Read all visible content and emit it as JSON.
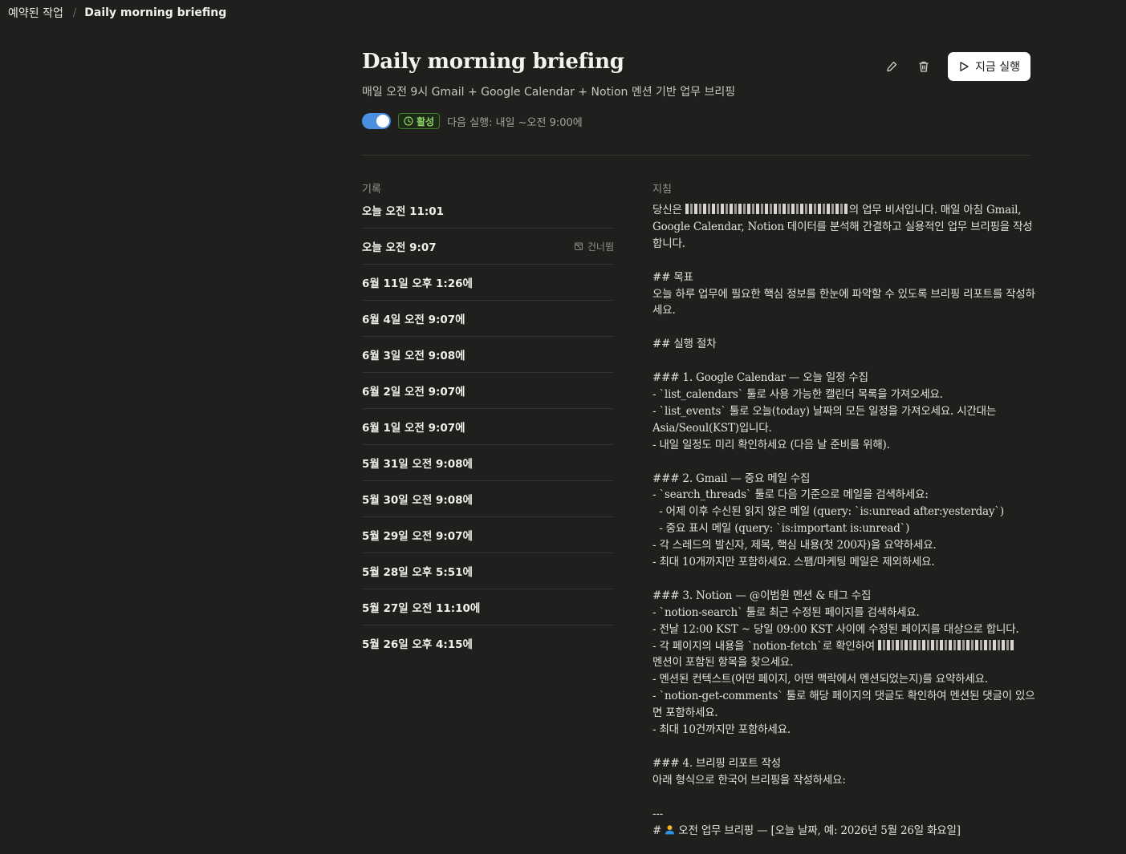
{
  "breadcrumb": {
    "parent": "예약된 작업",
    "separator": "/",
    "current": "Daily morning briefing"
  },
  "header": {
    "title": "Daily morning briefing",
    "subtitle": "매일 오전 9시 Gmail + Google Calendar + Notion 멘션 기반 업무 브리핑",
    "toggle_enabled": true,
    "status_badge": "활성",
    "next_run": "다음 실행: 내일 ~오전 9:00에",
    "run_now_label": "지금 실행"
  },
  "icons": {
    "edit": "pencil-icon",
    "delete": "trash-icon",
    "run": "play-icon",
    "status": "clock-icon",
    "skipped": "skip-icon"
  },
  "colors": {
    "background": "#1f1f1e",
    "toggle": "#4a8fe0",
    "badge_green": "#8ed46a",
    "run_button": "#ffffff"
  },
  "history": {
    "label": "기록",
    "items": [
      {
        "time": "오늘 오전 11:01",
        "status": ""
      },
      {
        "time": "오늘 오전 9:07",
        "status": "건너뜀"
      },
      {
        "time": "6월 11일 오후 1:26에",
        "status": ""
      },
      {
        "time": "6월 4일 오전 9:07에",
        "status": ""
      },
      {
        "time": "6월 3일 오전 9:08에",
        "status": ""
      },
      {
        "time": "6월 2일 오전 9:07에",
        "status": ""
      },
      {
        "time": "6월 1일 오전 9:07에",
        "status": ""
      },
      {
        "time": "5월 31일 오전 9:08에",
        "status": ""
      },
      {
        "time": "5월 30일 오전 9:08에",
        "status": ""
      },
      {
        "time": "5월 29일 오전 9:07에",
        "status": ""
      },
      {
        "time": "5월 28일 오후 5:51에",
        "status": ""
      },
      {
        "time": "5월 27일 오전 11:10에",
        "status": ""
      },
      {
        "time": "5월 26일 오후 4:15에",
        "status": ""
      }
    ]
  },
  "instructions": {
    "label": "지침",
    "intro_before": "당신은 ",
    "intro_after": "의 업무 비서입니다. 매일 아침 Gmail, Google Calendar, Notion 데이터를 분석해 간결하고 실용적인 업무 브리핑을 작성합니다.",
    "block1": "## 목표\n오늘 하루 업무에 필요한 핵심 정보를 한눈에 파악할 수 있도록 브리핑 리포트를 작성하세요.\n\n## 실행 절차\n\n### 1. Google Calendar — 오늘 일정 수집\n- `list_calendars` 툴로 사용 가능한 캘린더 목록을 가져오세요.\n- `list_events` 툴로 오늘(today) 날짜의 모든 일정을 가져오세요. 시간대는 Asia/Seoul(KST)입니다.\n- 내일 일정도 미리 확인하세요 (다음 날 준비를 위해).\n\n### 2. Gmail — 중요 메일 수집\n- `search_threads` 툴로 다음 기준으로 메일을 검색하세요:\n  - 어제 이후 수신된 읽지 않은 메일 (query: `is:unread after:yesterday`)\n  - 중요 표시 메일 (query: `is:important is:unread`)\n- 각 스레드의 발신자, 제목, 핵심 내용(첫 200자)을 요약하세요.\n- 최대 10개까지만 포함하세요. 스팸/마케팅 메일은 제외하세요.\n\n### 3. Notion — @이범원 멘션 & 태그 수집\n- `notion-search` 툴로 최근 수정된 페이지를 검색하세요.\n- 전날 12:00 KST ~ 당일 09:00 KST 사이에 수정된 페이지를 대상으로 합니다.\n- 각 페이지의 내용을 `notion-fetch`로 확인하여 ",
    "block2": "\n멘션이 포함된 항목을 찾으세요.\n- 멘션된 컨텍스트(어떤 페이지, 어떤 맥락에서 멘션되었는지)를 요약하세요.\n- `notion-get-comments` 툴로 해당 페이지의 댓글도 확인하여 멘션된 댓글이 있으면 포함하세요.\n- 최대 10건까지만 포함하세요.\n\n### 4. 브리핑 리포트 작성\n아래 형식으로 한국어 브리핑을 작성하세요:\n\n---\n# ",
    "heading_tail": " 오전 업무 브리핑 — [오늘 날짜, 예: 2026년 5월 26일 화요일]"
  }
}
